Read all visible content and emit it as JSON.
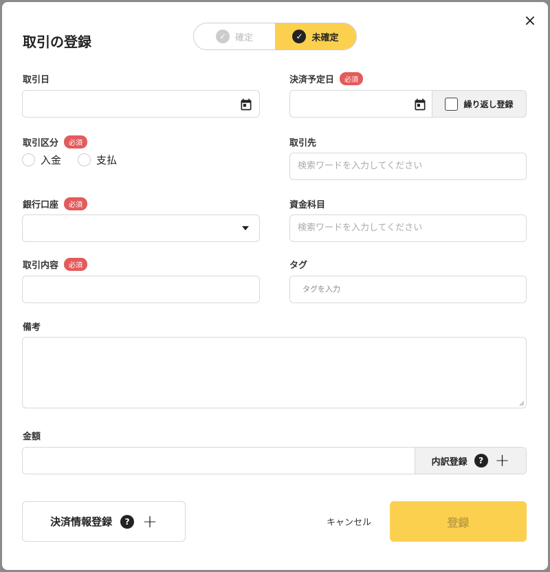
{
  "modal": {
    "title": "取引の登録",
    "close_label": "×"
  },
  "status_toggle": {
    "confirmed_label": "確定",
    "unconfirmed_label": "未確定",
    "selected": "未確定"
  },
  "required_badge": "必須",
  "fields": {
    "transaction_date": {
      "label": "取引日",
      "value": ""
    },
    "settlement_date": {
      "label": "決済予定日",
      "value": "",
      "repeat_label": "繰り返し登録"
    },
    "transaction_type": {
      "label": "取引区分",
      "options": [
        "入金",
        "支払"
      ]
    },
    "partner": {
      "label": "取引先",
      "placeholder": "検索ワードを入力してください"
    },
    "bank_account": {
      "label": "銀行口座",
      "value": ""
    },
    "account_title": {
      "label": "資金科目",
      "placeholder": "検索ワードを入力してください"
    },
    "content": {
      "label": "取引内容",
      "value": ""
    },
    "tag": {
      "label": "タグ",
      "placeholder": "タグを入力"
    },
    "memo": {
      "label": "備考",
      "value": ""
    },
    "amount": {
      "label": "金額",
      "value": "",
      "breakdown_label": "内訳登録"
    }
  },
  "footer": {
    "settlement_info_label": "決済情報登録",
    "cancel_label": "キャンセル",
    "submit_label": "登録"
  },
  "icons": {
    "help": "?",
    "plus": "+",
    "check": "✓"
  },
  "colors": {
    "accent": "#fcd04f",
    "required": "#e35b5b"
  }
}
